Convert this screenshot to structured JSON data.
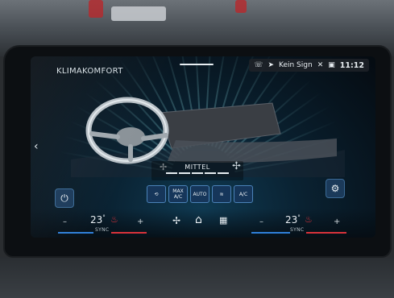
{
  "screen": {
    "title": "KLIMAKOMFORT",
    "status": {
      "signal_text": "Kein Sign",
      "time": "11:12"
    }
  },
  "fan": {
    "label": "MITTEL",
    "level_fraction": 0.5
  },
  "modes": [
    {
      "name": "recirculation-button",
      "label": "⟲"
    },
    {
      "name": "max-ac-button",
      "label": "MAX\nA/C"
    },
    {
      "name": "auto-button",
      "label": "AUTO"
    },
    {
      "name": "windshield-defrost-button",
      "label": "≋"
    },
    {
      "name": "ac-button",
      "label": "A/C"
    }
  ],
  "left_zone": {
    "temperature": "23",
    "unit": "°",
    "minus": "–",
    "plus": "+",
    "sync": "SYNC"
  },
  "right_zone": {
    "temperature": "23",
    "unit": "°",
    "minus": "–",
    "plus": "+",
    "sync": "SYNC"
  },
  "icons": {
    "power": "⏻",
    "settings": "⚙",
    "back": "‹",
    "home": "⌂",
    "fan": "✢",
    "grid": "▪"
  },
  "colors": {
    "accent_blue": "#2f7fd8",
    "accent_red": "#d8323a",
    "button_fill": "#16365a"
  }
}
